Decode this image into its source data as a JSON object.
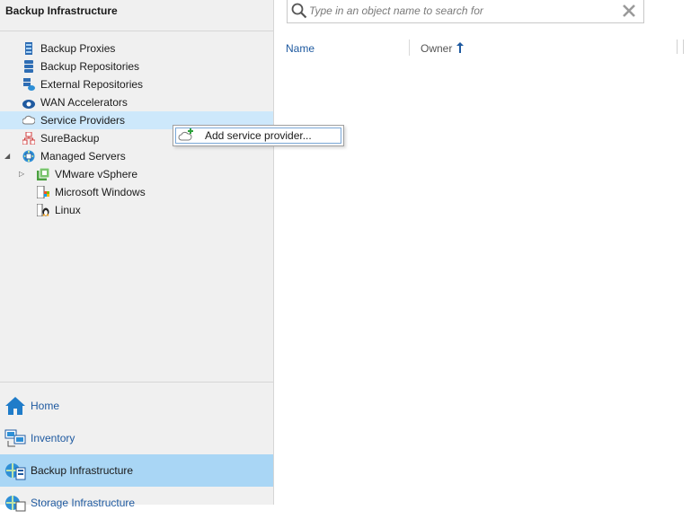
{
  "left_panel": {
    "header": "Backup Infrastructure",
    "tree": [
      {
        "label": "Backup Proxies",
        "icon": "proxy-icon"
      },
      {
        "label": "Backup Repositories",
        "icon": "repository-icon"
      },
      {
        "label": "External Repositories",
        "icon": "external-repository-icon"
      },
      {
        "label": "WAN Accelerators",
        "icon": "wan-accelerator-icon"
      },
      {
        "label": "Service Providers",
        "icon": "cloud-icon",
        "selected": true
      },
      {
        "label": "SureBackup",
        "icon": "surebackup-icon"
      },
      {
        "label": "Managed Servers",
        "icon": "managed-servers-icon",
        "expanded": true
      },
      {
        "label": "VMware vSphere",
        "icon": "vmware-icon"
      },
      {
        "label": "Microsoft Windows",
        "icon": "windows-server-icon"
      },
      {
        "label": "Linux",
        "icon": "linux-icon"
      }
    ],
    "nav": [
      {
        "label": "Home",
        "icon": "home-icon"
      },
      {
        "label": "Inventory",
        "icon": "inventory-icon"
      },
      {
        "label": "Backup Infrastructure",
        "icon": "backup-infrastructure-icon",
        "active": true
      },
      {
        "label": "Storage Infrastructure",
        "icon": "storage-infrastructure-icon"
      }
    ]
  },
  "search": {
    "placeholder": "Type in an object name to search for",
    "value": ""
  },
  "columns": [
    {
      "label": "Name"
    },
    {
      "label": "Owner",
      "sort": "ascending"
    }
  ],
  "context_menu": {
    "items": [
      {
        "label": "Add service provider...",
        "icon": "add-cloud-icon"
      }
    ]
  },
  "colors": {
    "accent": "#1f5aa0",
    "selection": "#cde8fb",
    "active_nav": "#a9d6f5",
    "panel_bg": "#f0f0f0"
  }
}
